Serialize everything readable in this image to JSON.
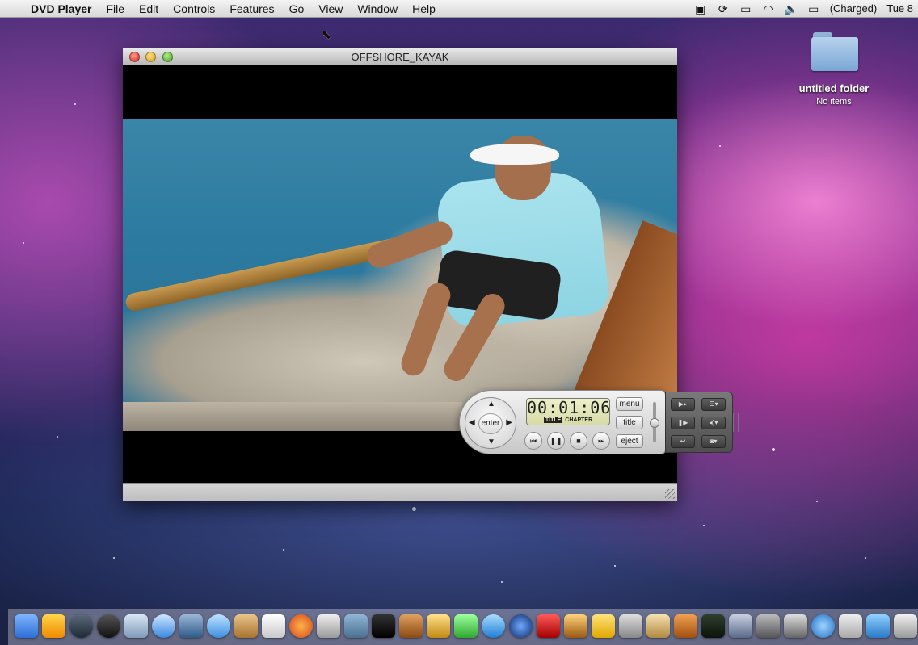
{
  "menubar": {
    "app_name": "DVD Player",
    "items": [
      "File",
      "Edit",
      "Controls",
      "Features",
      "Go",
      "View",
      "Window",
      "Help"
    ],
    "battery_status": "(Charged)",
    "clock": "Tue 8"
  },
  "desktop": {
    "folder_name": "untitled folder",
    "folder_sub": "No items"
  },
  "dvd_window": {
    "title": "OFFSHORE_KAYAK"
  },
  "controller": {
    "enter_label": "enter",
    "time": "00:01:06",
    "lcd_title_label": "TITLE",
    "lcd_chapter_label": "CHAPTER",
    "menu_label": "menu",
    "title_label": "title",
    "eject_label": "eject"
  }
}
